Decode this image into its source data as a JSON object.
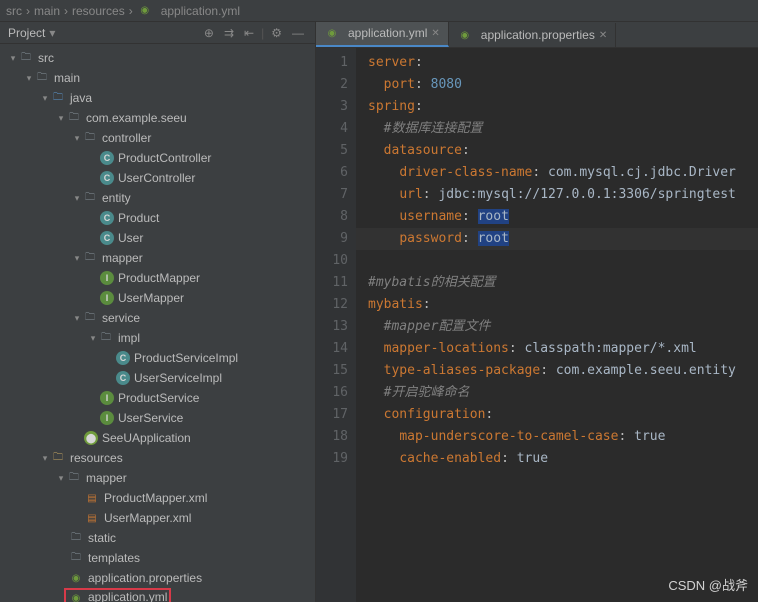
{
  "breadcrumb": {
    "p1": "src",
    "p2": "main",
    "p3": "resources",
    "p4": "application.yml"
  },
  "sidebar": {
    "title": "Project",
    "toolbar": {
      "collapse": "⇤",
      "opts": "⇉",
      "settings": "⚙",
      "hide": "—"
    }
  },
  "tree": {
    "src": "src",
    "main": "main",
    "java": "java",
    "pkg": "com.example.seeu",
    "controller": "controller",
    "productController": "ProductController",
    "userController": "UserController",
    "entity": "entity",
    "product": "Product",
    "user": "User",
    "mapper": "mapper",
    "productMapper": "ProductMapper",
    "userMapper": "UserMapper",
    "service": "service",
    "impl": "impl",
    "productServiceImpl": "ProductServiceImpl",
    "userServiceImpl": "UserServiceImpl",
    "productService": "ProductService",
    "userService": "UserService",
    "seeuApplication": "SeeUApplication",
    "resources": "resources",
    "mapperFolder": "mapper",
    "productMapperXml": "ProductMapper.xml",
    "userMapperXml": "UserMapper.xml",
    "static": "static",
    "templates": "templates",
    "appProperties": "application.properties",
    "appYml": "application.yml"
  },
  "tabs": {
    "tab1": "application.yml",
    "tab2": "application.properties"
  },
  "code": {
    "l1": {
      "k": "server",
      "c": ":"
    },
    "l2": {
      "k": "port",
      "c": ": ",
      "v": "8080"
    },
    "l3": {
      "k": "spring",
      "c": ":"
    },
    "l4": {
      "c": "#数据库连接配置"
    },
    "l5": {
      "k": "datasource",
      "c": ":"
    },
    "l6": {
      "k": "driver-class-name",
      "c": ": ",
      "v": "com.mysql.cj.jdbc.Driver"
    },
    "l7": {
      "k": "url",
      "c": ": ",
      "v": "jdbc:mysql://127.0.0.1:3306/springtest"
    },
    "l8": {
      "k": "username",
      "c": ": ",
      "v": "root"
    },
    "l9": {
      "k": "password",
      "c": ": ",
      "v": "root"
    },
    "l11": {
      "c": "#mybatis的相关配置"
    },
    "l12": {
      "k": "mybatis",
      "c": ":"
    },
    "l13": {
      "c": "#mapper配置文件"
    },
    "l14": {
      "k": "mapper-locations",
      "c": ": ",
      "v": "classpath:mapper/*.xml"
    },
    "l15": {
      "k": "type-aliases-package",
      "c": ": ",
      "v": "com.example.seeu.entity"
    },
    "l16": {
      "c": "#开启驼峰命名"
    },
    "l17": {
      "k": "configuration",
      "c": ":"
    },
    "l18": {
      "k": "map-underscore-to-camel-case",
      "c": ": ",
      "v": "true"
    },
    "l19": {
      "k": "cache-enabled",
      "c": ": ",
      "v": "true"
    }
  },
  "watermark": "CSDN @战斧"
}
